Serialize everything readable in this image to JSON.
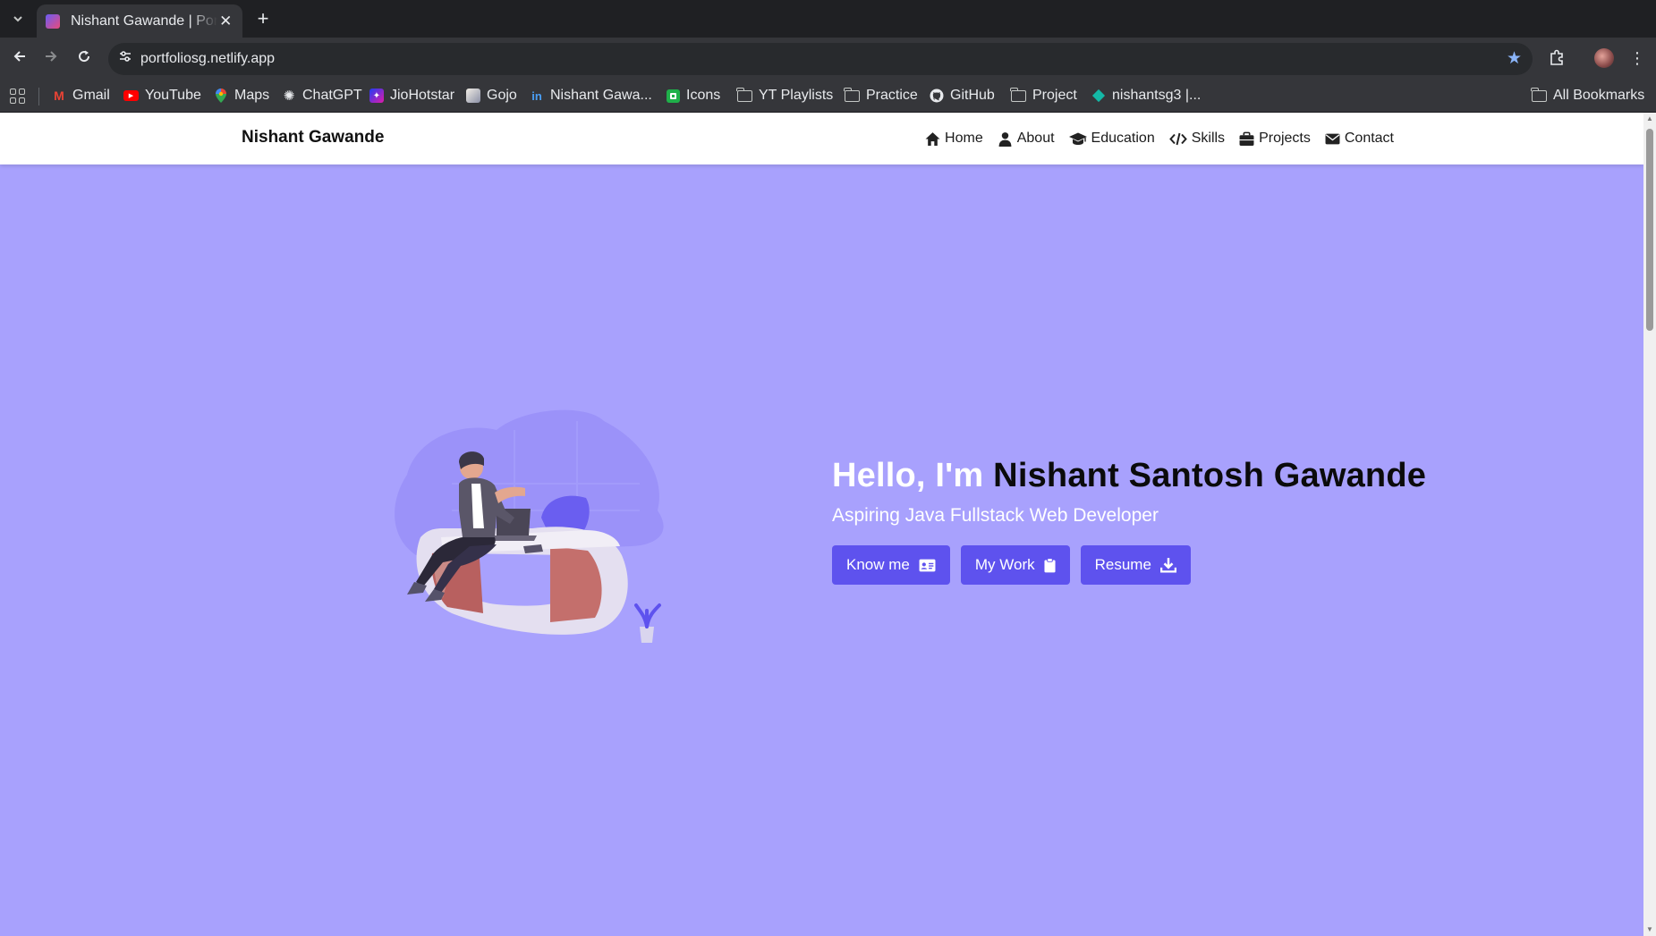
{
  "browser": {
    "tab": {
      "title": "Nishant Gawande | Portfolio",
      "close_glyph": "✕"
    },
    "new_tab_glyph": "+",
    "url": "portfoliosg.netlify.app",
    "bookmarks": [
      {
        "label": "Gmail",
        "icon": "gmail-icon"
      },
      {
        "label": "YouTube",
        "icon": "youtube-icon"
      },
      {
        "label": "Maps",
        "icon": "maps-icon"
      },
      {
        "label": "ChatGPT",
        "icon": "chatgpt-icon"
      },
      {
        "label": "JioHotstar",
        "icon": "jiohotstar-icon"
      },
      {
        "label": "Gojo",
        "icon": "gojo-icon"
      },
      {
        "label": "Nishant Gawa...",
        "icon": "linkedin-icon"
      },
      {
        "label": "Icons",
        "icon": "icons-app-icon"
      },
      {
        "label": "YT Playlists",
        "icon": "folder-icon"
      },
      {
        "label": "Practice",
        "icon": "folder-icon"
      },
      {
        "label": "GitHub",
        "icon": "github-icon"
      },
      {
        "label": "Project",
        "icon": "folder-icon"
      },
      {
        "label": "nishantsg3 |...",
        "icon": "diamond-icon"
      }
    ],
    "all_bookmarks": "All Bookmarks",
    "colors": {
      "tabstrip": "#1f2023",
      "toolbar": "#35363a",
      "omnibox": "#282a2d",
      "star": "#8ab4f8"
    }
  },
  "site": {
    "brand": "Nishant Gawande",
    "nav": [
      {
        "label": "Home",
        "icon": "home-icon"
      },
      {
        "label": "About",
        "icon": "user-icon"
      },
      {
        "label": "Education",
        "icon": "graduation-cap-icon"
      },
      {
        "label": "Skills",
        "icon": "code-icon"
      },
      {
        "label": "Projects",
        "icon": "briefcase-icon"
      },
      {
        "label": "Contact",
        "icon": "envelope-icon"
      }
    ],
    "hero": {
      "greeting": "Hello, I'm",
      "name": "Nishant Santosh Gawande",
      "tagline": "Aspiring Java Fullstack Web Developer",
      "buttons": [
        {
          "label": "Know me",
          "icon": "id-card-icon"
        },
        {
          "label": "My Work",
          "icon": "clipboard-icon"
        },
        {
          "label": "Resume",
          "icon": "download-icon"
        }
      ]
    },
    "colors": {
      "hero_bg": "#a8a1fd",
      "button": "#5e52ee",
      "nav_bg": "#ffffff"
    }
  }
}
